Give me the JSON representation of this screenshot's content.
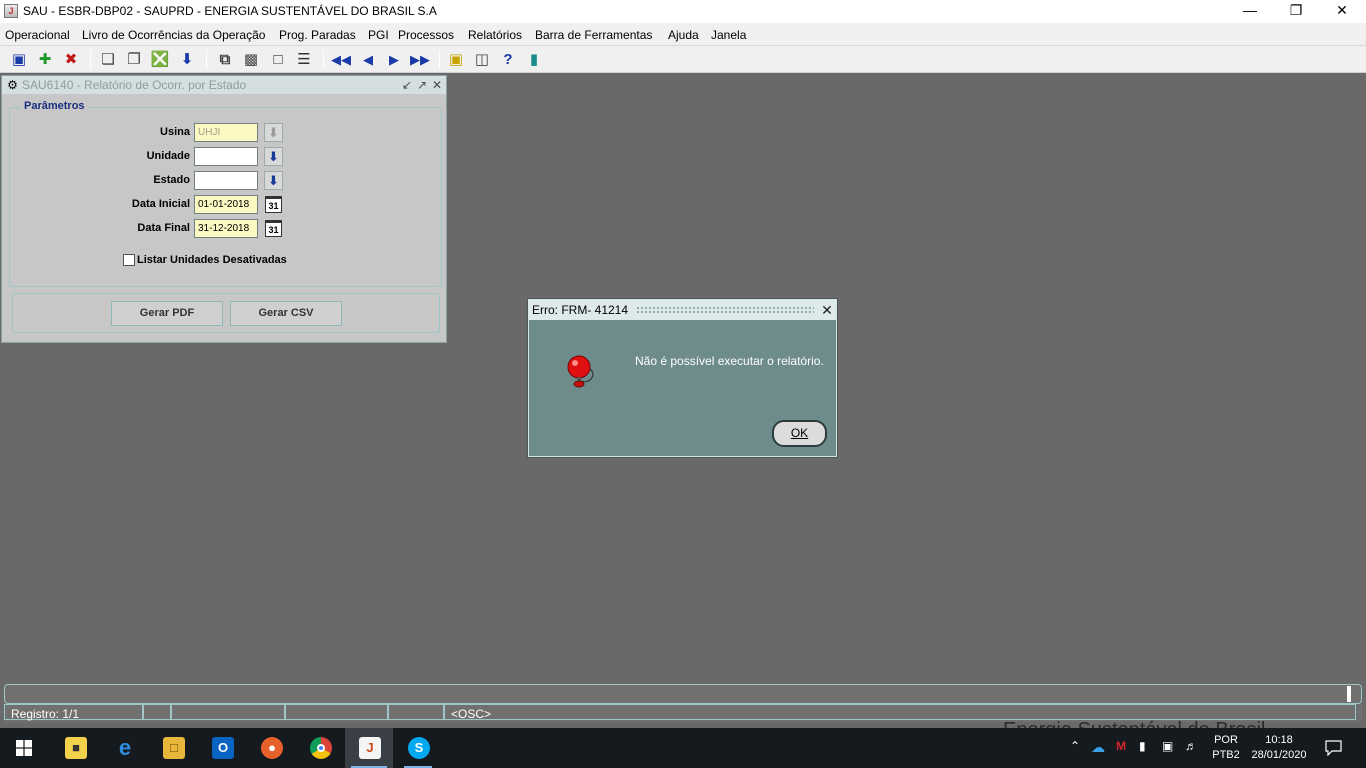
{
  "window": {
    "title": "SAU - ESBR-DBP02 - SAUPRD - ENERGIA SUSTENTÁVEL DO BRASIL S.A"
  },
  "menu": [
    "Operacional",
    "Livro de Ocorrências da Operação",
    "Prog. Paradas",
    "PGI",
    "Processos",
    "Relatórios",
    "Barra de Ferramentas",
    "Ajuda",
    "Janela"
  ],
  "toolbar": {
    "icons": [
      "save-icon",
      "insert-record-icon",
      "delete-record-icon",
      "query-icon",
      "execute-query-icon",
      "cancel-query-icon",
      "download-icon",
      "copy-icon",
      "paste-icon",
      "edit-icon",
      "list-icon",
      "first-record-icon",
      "previous-record-icon",
      "next-record-icon",
      "last-record-icon",
      "lock-icon",
      "print-icon",
      "help-icon",
      "exit-icon"
    ]
  },
  "form": {
    "title": "SAU6140 - Relatório de Ocorr. por Estado",
    "frame_label": "Parâmetros",
    "usina_label": "Usina",
    "usina_value": "UHJI",
    "unidade_label": "Unidade",
    "unidade_value": "",
    "estado_label": "Estado",
    "estado_value": "",
    "data_inicial_label": "Data Inicial",
    "data_inicial_value": "01-01-2018",
    "data_final_label": "Data Final",
    "data_final_value": "31-12-2018",
    "checkbox_label": "Listar Unidades Desativadas",
    "checkbox_checked": false,
    "pdf_button": "Gerar PDF",
    "csv_button": "Gerar CSV"
  },
  "dialog": {
    "title": "Erro: FRM- 41214",
    "message": "Não é possível executar o relatório.",
    "ok_button": "OK",
    "icon": "alarm-bell-icon"
  },
  "statusbar": {
    "record": "Registro: 1/1",
    "mode": "<OSC>",
    "background_text": "Energia Sustentável do Brasil"
  },
  "taskbar": {
    "apps": [
      "sticky-notes-icon",
      "internet-explorer-icon",
      "file-explorer-icon",
      "outlook-icon",
      "firefox-icon",
      "chrome-icon",
      "java-icon",
      "skype-icon"
    ],
    "active_app": "java-icon",
    "tray_icons": [
      "chevron-up-icon",
      "onedrive-icon",
      "mcafee-icon",
      "battery-icon",
      "network-icon",
      "volume-icon"
    ],
    "language_top": "POR",
    "language_bottom": "PTB2",
    "time": "10:18",
    "date": "28/01/2020"
  }
}
